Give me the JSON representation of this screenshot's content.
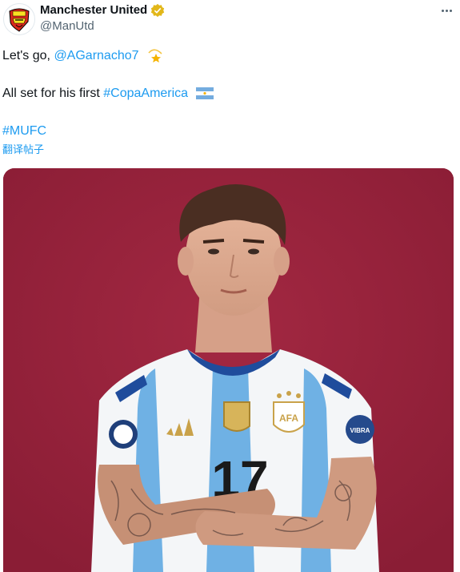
{
  "author": {
    "display_name": "Manchester United",
    "handle": "@ManUtd",
    "avatar_icon": "manchester-united-crest-icon",
    "verified_icon": "verified-gold-badge-icon"
  },
  "tweet": {
    "line1_prefix": "Let's go, ",
    "mention": "@AGarnacho7",
    "line1_emoji": "dizzy-star-emoji",
    "line2_prefix": "All set for his first ",
    "hashtag_copa": "#CopaAmerica",
    "line2_emoji": "argentina-flag-emoji",
    "hashtag_mufc": "#MUFC",
    "translate_label": "翻译帖子"
  },
  "media": {
    "alt_icon": "player-photo",
    "background_color": "#94213a",
    "shirt_number": "17",
    "badge_text": "AFA"
  },
  "colors": {
    "link": "#1d9bf0",
    "text": "#0f1419",
    "secondary": "#536471"
  }
}
